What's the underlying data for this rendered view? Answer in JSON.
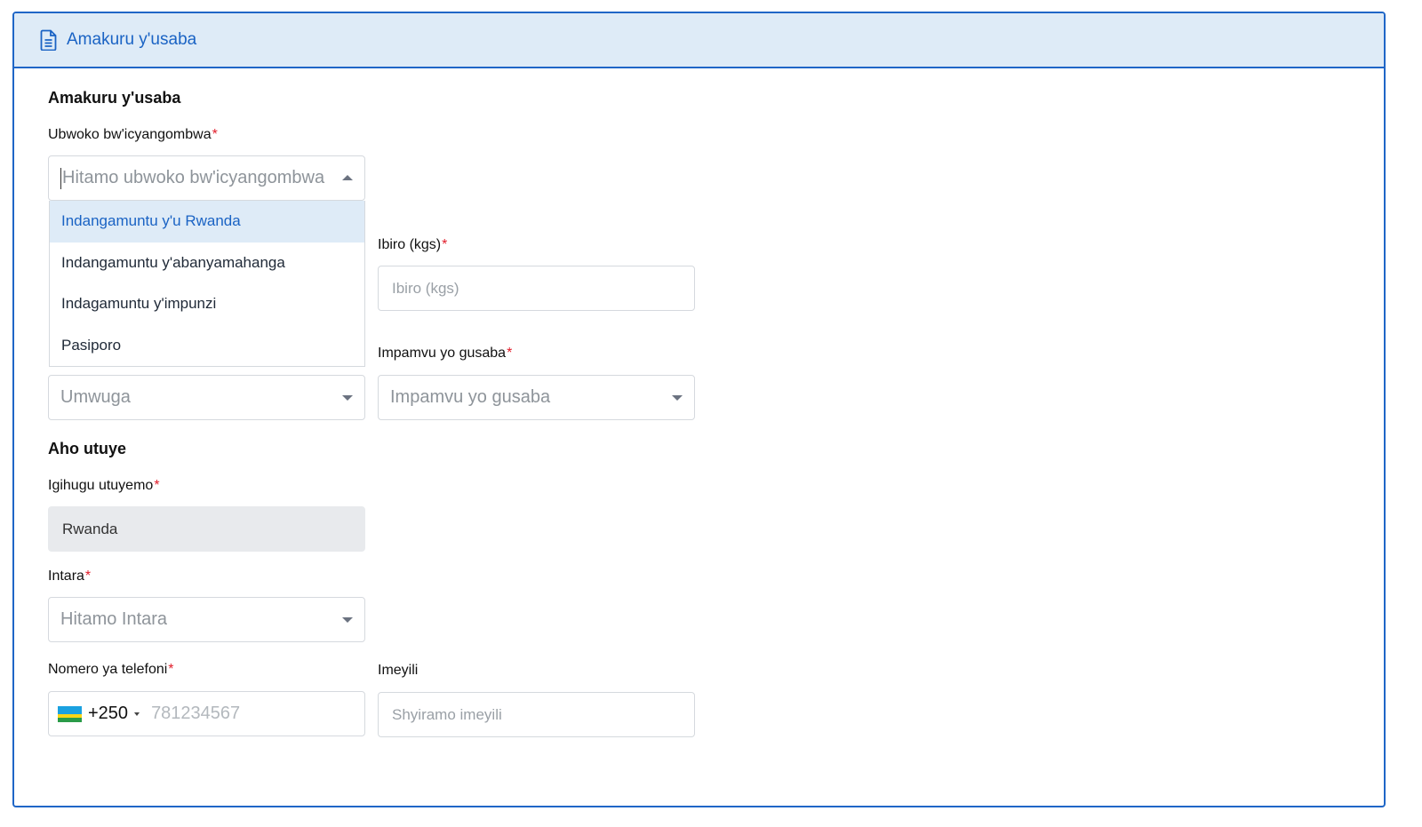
{
  "header": {
    "icon": "document-icon",
    "title": "Amakuru y'usaba"
  },
  "application_section": {
    "title": "Amakuru y'usaba",
    "id_type": {
      "label": "Ubwoko bw'icyangombwa",
      "required": "*",
      "placeholder": "Hitamo ubwoko bw'icyangombwa",
      "options": [
        "Indangamuntu y'u Rwanda",
        "Indangamuntu y'abanyamahanga",
        "Indagamuntu y'impunzi",
        "Pasiporo"
      ],
      "highlighted_option": "Indangamuntu y'u Rwanda"
    },
    "weight": {
      "label": "Ibiro (kgs)",
      "required": "*",
      "placeholder": "Ibiro (kgs)"
    },
    "occupation": {
      "placeholder": "Umwuga"
    },
    "reason": {
      "label": "Impamvu yo gusaba",
      "required": "*",
      "placeholder": "Impamvu yo gusaba"
    }
  },
  "residence_section": {
    "title": "Aho utuye",
    "country": {
      "label": "Igihugu utuyemo",
      "required": "*",
      "value": "Rwanda"
    },
    "province": {
      "label": "Intara",
      "required": "*",
      "placeholder": "Hitamo Intara"
    },
    "phone": {
      "label": "Nomero ya telefoni",
      "required": "*",
      "dial_code": "+250",
      "placeholder": "781234567",
      "flag": "rwanda-flag-icon"
    },
    "email": {
      "label": "Imeyili",
      "placeholder": "Shyiramo imeyili"
    }
  },
  "colors": {
    "accent": "#1a63c4",
    "header_bg": "#deebf7",
    "required": "#e11d2a",
    "border": "#1f66c7"
  }
}
